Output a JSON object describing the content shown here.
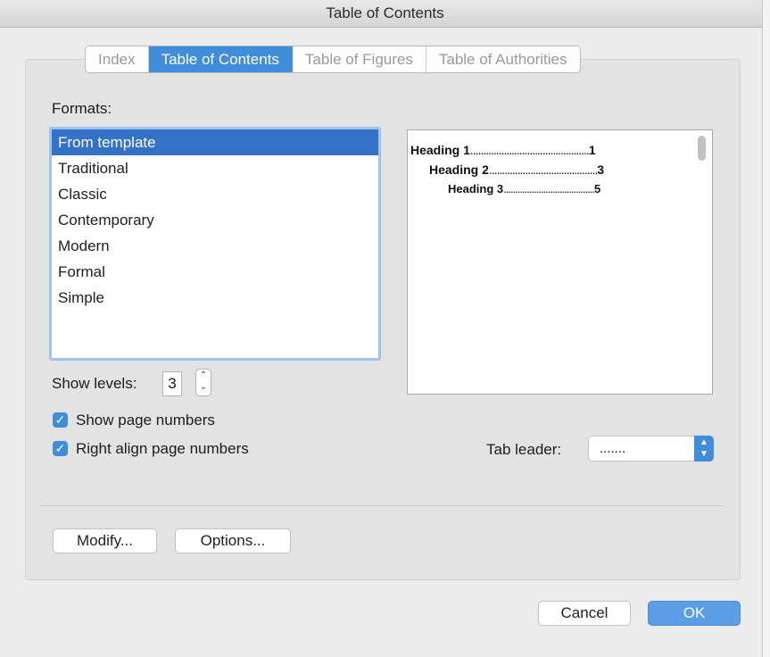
{
  "window": {
    "title": "Table of Contents"
  },
  "tabs": [
    {
      "label": "Index",
      "active": false
    },
    {
      "label": "Table of Contents",
      "active": true
    },
    {
      "label": "Table of Figures",
      "active": false
    },
    {
      "label": "Table of Authorities",
      "active": false
    }
  ],
  "formats": {
    "label": "Formats:",
    "items": [
      "From template",
      "Traditional",
      "Classic",
      "Contemporary",
      "Modern",
      "Formal",
      "Simple"
    ],
    "selected": "From template"
  },
  "preview": {
    "lines": [
      {
        "text": "Heading 1",
        "leader": "..............................................",
        "page": "1"
      },
      {
        "text": "Heading 2",
        "leader": "..........................................",
        "page": "3"
      },
      {
        "text": "Heading 3",
        "leader": ".......................................",
        "page": "5"
      }
    ]
  },
  "show_levels": {
    "label": "Show levels:",
    "value": "3"
  },
  "options": {
    "show_page_numbers": {
      "label": "Show page numbers",
      "checked": true
    },
    "right_align": {
      "label": "Right align page numbers",
      "checked": true
    }
  },
  "tab_leader": {
    "label": "Tab leader:",
    "value": "......."
  },
  "buttons": {
    "modify": "Modify...",
    "options": "Options...",
    "cancel": "Cancel",
    "ok": "OK"
  },
  "colors": {
    "accent": "#3f8ddb",
    "selection": "#3372c6"
  },
  "icons": {
    "checkbox": "checkmark-icon",
    "stepper": "up-down-chevron-icon"
  }
}
